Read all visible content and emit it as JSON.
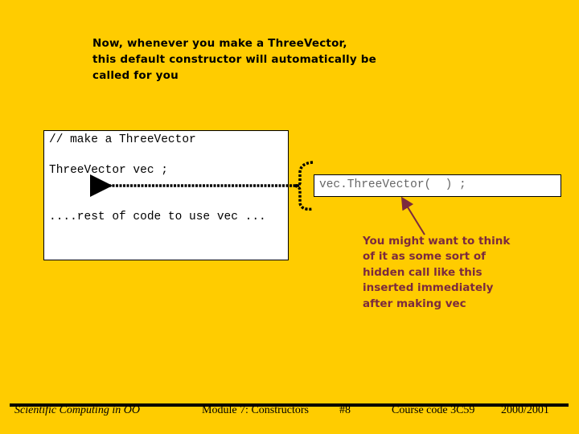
{
  "slide": {
    "intro_text": "Now, whenever you make a ThreeVector,\nthis default constructor will automatically be\ncalled for you",
    "code_box": {
      "lines": [
        "// make a ThreeVector",
        "ThreeVector vec ;",
        "....rest of code to use vec ..."
      ]
    },
    "hidden_call": "vec.ThreeVector(  ) ;",
    "note_text": "You might want to think\nof it as some sort of\nhidden call like this\ninserted immediately\nafter making vec",
    "colors": {
      "background": "#FFCC00",
      "note": "#7B2A3E",
      "hidden_call_text": "#666666"
    }
  },
  "footer": {
    "course_title": "Scientific Computing in OO",
    "module": "Module 7: Constructors",
    "slide_number": "#8",
    "course_code": "Course code 3C59",
    "year": "2000/2001"
  }
}
